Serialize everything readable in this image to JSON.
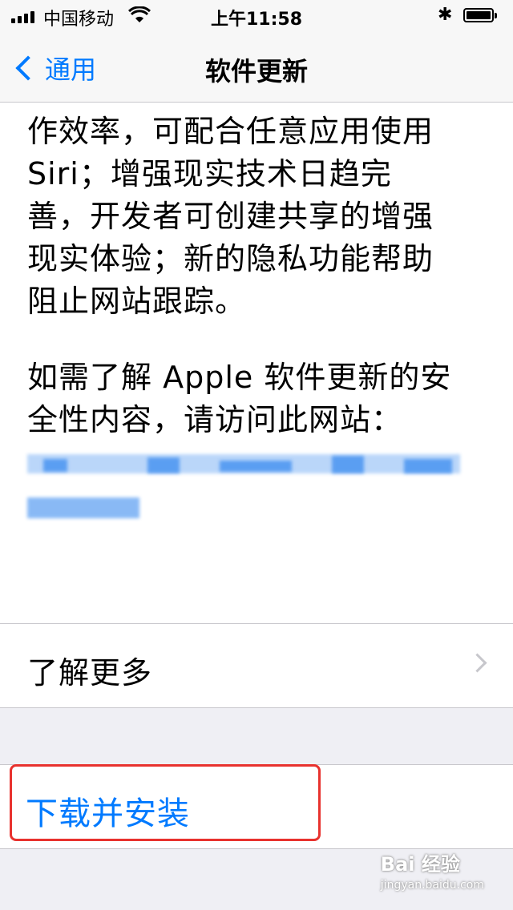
{
  "status_bar": {
    "carrier": "中国移动",
    "time": "上午11:58",
    "bluetooth": "✱",
    "icons": [
      "signal-icon",
      "wifi-icon",
      "bluetooth-icon",
      "battery-icon"
    ]
  },
  "nav": {
    "back_label": "通用",
    "title": "软件更新"
  },
  "content": {
    "description_lines": [
      "作效率，可配合任意应用使用",
      "Siri；增强现实技术日趋完",
      "善，开发者可创建共享的增强",
      "现实体验；新的隐私功能帮助",
      "阻止网站跟踪。"
    ],
    "security_lines": [
      "如需了解 Apple 软件更新的安",
      "全性内容，请访问此网站："
    ]
  },
  "learn_more": {
    "label": "了解更多"
  },
  "download": {
    "label": "下载并安装"
  },
  "watermark": {
    "brand": "Bai 经验",
    "url": "jingyan.baidu.com"
  },
  "colors": {
    "accent": "#007aff",
    "highlight": "#e8322e",
    "background": "#efeff4"
  }
}
